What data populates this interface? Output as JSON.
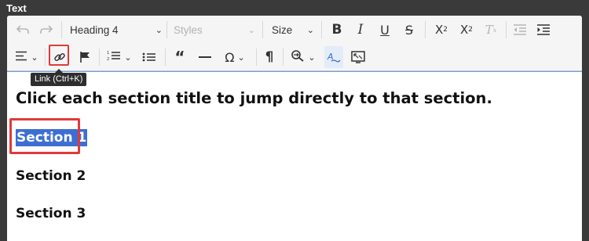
{
  "panel": {
    "label": "Text"
  },
  "toolbar": {
    "heading_dropdown": "Heading 4",
    "styles_dropdown": "Styles",
    "size_dropdown": "Size",
    "link_tooltip": "Link (Ctrl+K)",
    "icons": [
      "undo-icon",
      "redo-icon",
      "bold-icon",
      "italic-icon",
      "underline-icon",
      "strikethrough-icon",
      "subscript-icon",
      "superscript-icon",
      "remove-format-icon",
      "outdent-icon",
      "indent-icon",
      "align-icon",
      "link-icon",
      "anchor-flag-icon",
      "numbered-list-icon",
      "bulleted-list-icon",
      "blockquote-icon",
      "horizontal-line-icon",
      "special-char-icon",
      "show-blocks-icon",
      "find-replace-icon",
      "spellcheck-icon",
      "maximize-icon"
    ]
  },
  "content": {
    "intro": "Click each section title to jump directly to that section.",
    "sections": [
      "Section 1",
      "Section 2",
      "Section 3"
    ]
  },
  "colors": {
    "selection": "#3d6fd1",
    "highlight_box": "#e03a3a",
    "focus_border": "#6f9fe0"
  }
}
